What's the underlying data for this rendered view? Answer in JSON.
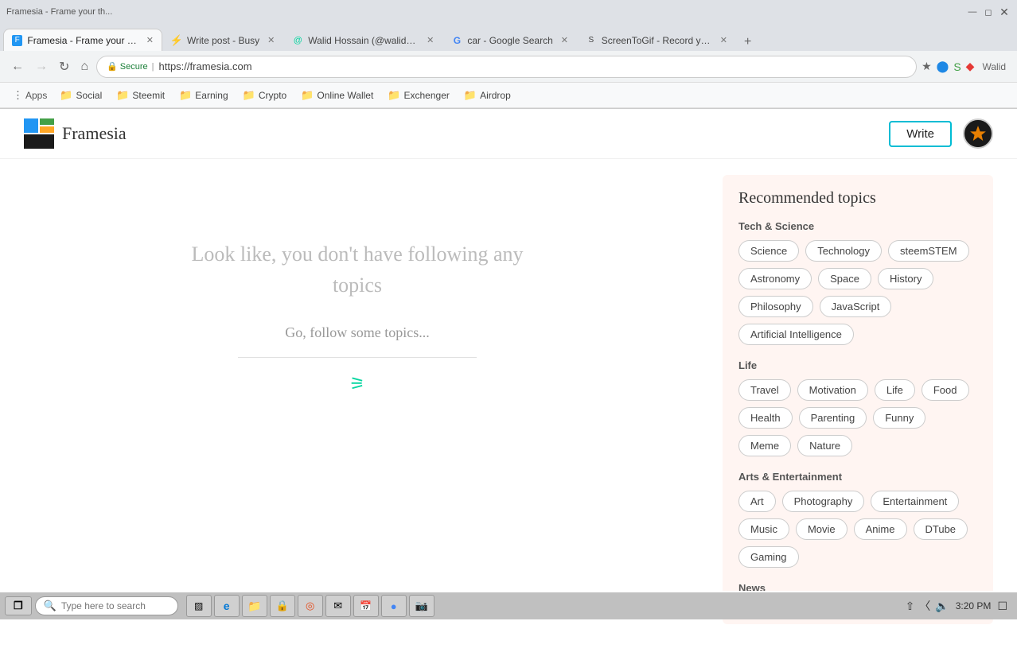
{
  "browser": {
    "tabs": [
      {
        "id": "tab1",
        "label": "Framesia - Frame your th...",
        "active": true,
        "favicon": "F"
      },
      {
        "id": "tab2",
        "label": "Write post - Busy",
        "active": false,
        "favicon": "⚡"
      },
      {
        "id": "tab3",
        "label": "Walid Hossain (@walid3...",
        "active": false,
        "favicon": "@"
      },
      {
        "id": "tab4",
        "label": "car - Google Search",
        "active": false,
        "favicon": "G"
      },
      {
        "id": "tab5",
        "label": "ScreenToGif - Record yo...",
        "active": false,
        "favicon": "S"
      }
    ],
    "url": "https://framesia.com",
    "secure_label": "Secure",
    "user_label": "Walid"
  },
  "bookmarks": [
    {
      "label": "Apps",
      "type": "apps"
    },
    {
      "label": "Social",
      "type": "folder"
    },
    {
      "label": "Steemit",
      "type": "folder"
    },
    {
      "label": "Earning",
      "type": "folder"
    },
    {
      "label": "Crypto",
      "type": "folder"
    },
    {
      "label": "Online Wallet",
      "type": "folder"
    },
    {
      "label": "Exchenger",
      "type": "folder"
    },
    {
      "label": "Airdrop",
      "type": "folder"
    }
  ],
  "site": {
    "logo_text": "Framesia",
    "write_button": "Write",
    "empty_state_line1": "Look like, you don't have following any",
    "empty_state_line2": "topics",
    "follow_hint": "Go, follow some topics...",
    "recommended_title": "Recommended topics",
    "sections": [
      {
        "label": "Tech & Science",
        "tags": [
          "Science",
          "Technology",
          "steemSTEM",
          "Astronomy",
          "Space",
          "History",
          "Philosophy",
          "JavaScript",
          "Artificial Intelligence"
        ]
      },
      {
        "label": "Life",
        "tags": [
          "Travel",
          "Motivation",
          "Life",
          "Food",
          "Health",
          "Parenting",
          "Funny",
          "Meme",
          "Nature"
        ]
      },
      {
        "label": "Arts & Entertainment",
        "tags": [
          "Art",
          "Photography",
          "Entertainment",
          "Music",
          "Movie",
          "Anime",
          "DTube",
          "Gaming"
        ]
      },
      {
        "label": "News",
        "tags": []
      }
    ]
  },
  "taskbar": {
    "search_placeholder": "Type here to search",
    "time": "3:20 PM"
  }
}
